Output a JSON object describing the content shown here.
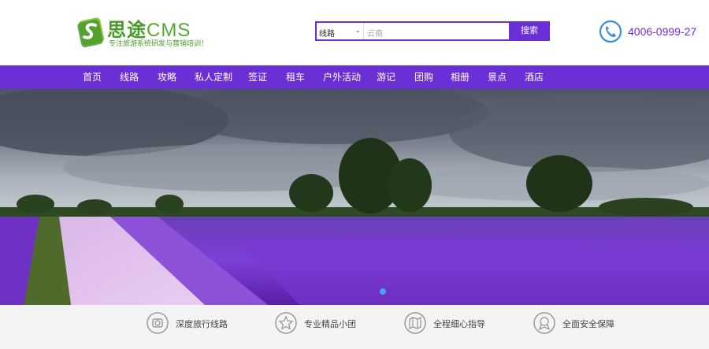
{
  "header": {
    "logo_title": "思途",
    "logo_cms": "CMS",
    "logo_sub": "专注旅游系统研发与营销培训！",
    "search": {
      "select_value": "线路",
      "placeholder": "云南",
      "button_label": "搜索"
    },
    "phone": "4006-0999-27"
  },
  "nav": {
    "items": [
      {
        "label": "首页"
      },
      {
        "label": "线路"
      },
      {
        "label": "攻略"
      },
      {
        "label": "私人定制"
      },
      {
        "label": "签证"
      },
      {
        "label": "租车"
      },
      {
        "label": "户外活动"
      },
      {
        "label": "游记"
      },
      {
        "label": "团购"
      },
      {
        "label": "相册"
      },
      {
        "label": "景点"
      },
      {
        "label": "酒店"
      }
    ]
  },
  "features": [
    {
      "label": "深度旅行线路",
      "icon": "camera-icon"
    },
    {
      "label": "专业精品小团",
      "icon": "star-icon"
    },
    {
      "label": "全程细心指导",
      "icon": "map-icon"
    },
    {
      "label": "全面安全保障",
      "icon": "shield-icon"
    }
  ],
  "colors": {
    "accent": "#6b2fd6",
    "logo_green": "#4a9a2a",
    "carousel_dot": "#4aa3f0"
  }
}
